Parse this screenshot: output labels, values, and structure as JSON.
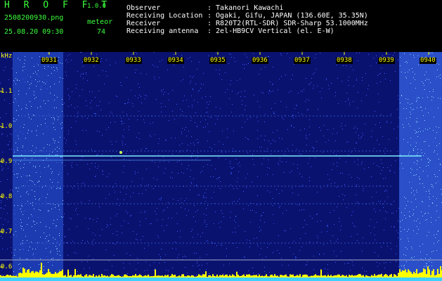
{
  "header": {
    "app_name": "H R O F F T",
    "version": "1.0.0",
    "filename": "2508200930.png",
    "datetime": "25.08.20 09:30",
    "meteor_label": "meteor",
    "meteor_count": "74",
    "info": [
      {
        "label": "Observer",
        "value": ": Takanori Kawachi"
      },
      {
        "label": "Receiving Location",
        "value": ": Ogaki, Gifu, JAPAN (136.60E, 35.35N)"
      },
      {
        "label": "Receiver",
        "value": ": R820T2(RTL-SDR) SDR-Sharp 53.1000MHz"
      },
      {
        "label": "Receiving antenna",
        "value": ": 2el-HB9CV Vertical (el. E-W)"
      }
    ]
  },
  "spectrogram": {
    "unit": "kHz",
    "y_ticks": [
      "1.1",
      "1.0",
      "0.9",
      "0.8",
      "0.7",
      "0.6"
    ],
    "x_ticks": [
      "0931",
      "0932",
      "0933",
      "0934",
      "0935",
      "0936",
      "0937",
      "0938",
      "0939",
      "0940"
    ],
    "colors": {
      "background": "#0a1270",
      "trace": "#7cf0ff",
      "level": "#ffff00",
      "axis_text": "#ffff00",
      "header_text": "#3cff3c"
    }
  }
}
